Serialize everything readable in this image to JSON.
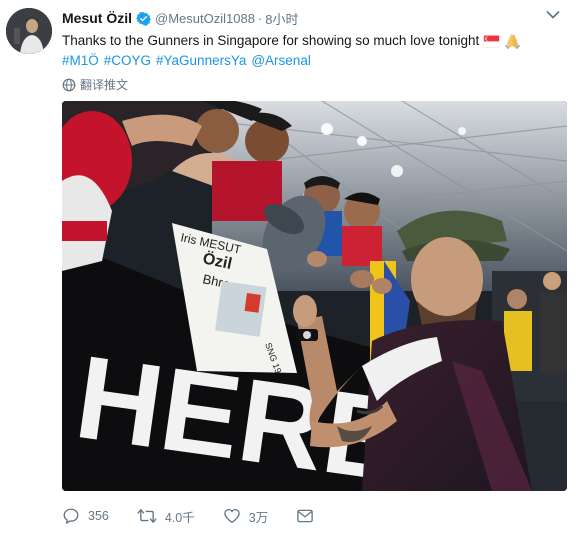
{
  "tweet": {
    "display_name": "Mesut Özil",
    "handle": "@MesutOzil1088",
    "separator": "·",
    "time": "8小时",
    "text": "Thanks to the Gunners in Singapore for showing so much love tonight",
    "hashtags": [
      "#M1Ö",
      "#COYG",
      "#YaGunnersYa",
      "@Arsenal"
    ],
    "translate_label": "翻译推文",
    "photo_banner_text": "HERE",
    "sign_text": [
      "Iris MESUT",
      "Özil",
      "Bhre",
      "SNG 19"
    ],
    "actions": {
      "reply_count": "356",
      "retweet_count": "4.0千",
      "like_count": "3万"
    }
  },
  "colors": {
    "link": "#1b95e0",
    "secondary_text": "#657786",
    "verified_badge": "#1da1f2"
  },
  "icons": {
    "verified": "verified-badge-icon",
    "menu": "chevron-down-icon",
    "translate": "globe-icon",
    "reply": "reply-icon",
    "retweet": "retweet-icon",
    "like": "heart-icon",
    "message": "envelope-icon"
  }
}
